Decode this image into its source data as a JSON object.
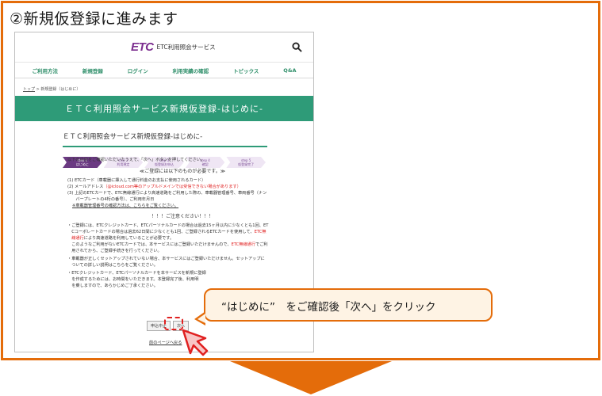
{
  "step_heading": "②新規仮登録に進みます",
  "site": {
    "logo_mark": "ETC",
    "logo_text": "ETC利用照会サービス",
    "nav": [
      "ご利用方法",
      "新規登録",
      "ログイン",
      "利用実績の確認",
      "トピックス",
      "Q&A"
    ],
    "breadcrumb_home": "トップ",
    "breadcrumb_current": "新規登録（はじめに）",
    "banner": "ＥＴＣ利用照会サービス新規仮登録-はじめに-",
    "page_heading": "ＥＴＣ利用照会サービス新規仮登録-はじめに-",
    "steps": [
      {
        "num": "step 1",
        "label": "はじめに"
      },
      {
        "num": "step 2",
        "label": "利用規定"
      },
      {
        "num": "step 3",
        "label": "仮登録お申込"
      },
      {
        "num": "step 4",
        "label": "確認"
      },
      {
        "num": "step 5",
        "label": "仮登録完了"
      }
    ],
    "intro": "以下の内容をご確認いただいたうえで、「次へ」ボタンを押してください。",
    "required_heading": "≪ご登録には以下のものが必要です。≫",
    "req1": "(1) ETCカード（車載器に挿入して通行料金のお支払に使用されるカード）",
    "req2_a": "(2) メールアドレス",
    "req2_b": "（@icloud.com等のアップルドメインでは受信できない場合があります）",
    "req3_a": "(3) 上記のETCカードで、ETC無線通行により高速道路をご利用した際の、車載器管理番号、車両番号（ナン",
    "req3_b": "　　バープレートの4桁の番号）、ご利用年月日",
    "req3_link": "※車載器管理番号の確認方法は、こちらをご覧ください。",
    "caution_heading": "！！！ご注意ください！！！",
    "c1_a": "・ご登録には、ETCクレジットカード、ETCパーソナルカードの場合は過去15ヶ月以内に少なくとも1回、ET",
    "c1_b": "　Cコーポレートカードの場合は過去62日間に少なくとも1回、ご登録されるETCカードを使用して、",
    "c1_c": "ETC無",
    "c1_d": "　線通行",
    "c1_e": "により高速道路を利用していることが必要です。",
    "c1_f": "　このようなご利用がないETCカードでは、本サービスにはご登録いただけませんので、",
    "c1_g": "ETC無線通行",
    "c1_h": "でご利",
    "c1_i": "　用されてから、ご登録手続きを行ってください。",
    "c2_a": "・車載器が正しくセットアップされていない場合、本サービスにはご登録いただけません。セットアップに",
    "c2_b": "　ついての詳しい説明はこちらをご覧ください。",
    "c3_a": "・ETCクレジットカード、ETCパーソナルカードを本サービスを新規に登録",
    "c3_b": "　を作成するためには、お時間をいただきます。本登録完了後、利用明",
    "c3_c": "　を乗しますので、あらかじめご了承ください。",
    "btn_cancel": "申込中止",
    "btn_next": "次へ",
    "back_link": "前のページへ戻る"
  },
  "callout": "“はじめに”　をご確認後「次へ」をクリック",
  "colors": {
    "accent_orange": "#e46c0a",
    "site_green": "#2e9b78",
    "step_purple": "#6b3a82",
    "warning_red": "#e02020"
  }
}
